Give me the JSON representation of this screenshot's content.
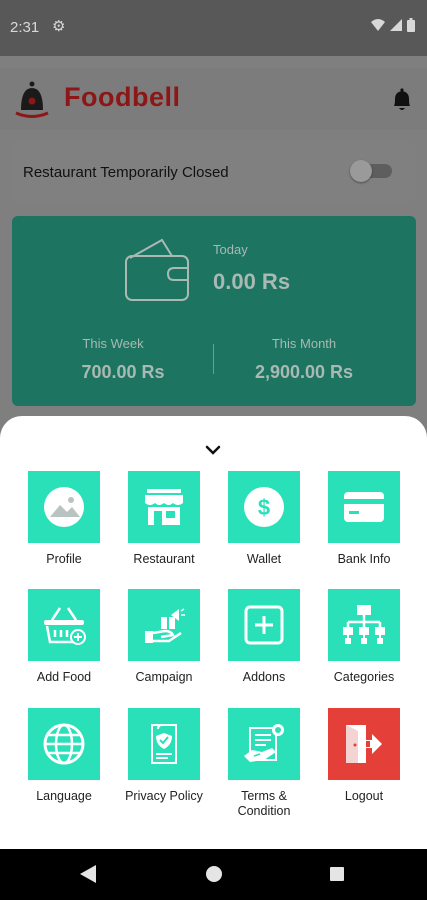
{
  "status_bar": {
    "time": "2:31"
  },
  "app": {
    "logo_text": "Foodbell"
  },
  "restaurant_status": {
    "label": "Restaurant Temporarily Closed",
    "toggle_on": false
  },
  "earnings": {
    "today_label": "Today",
    "today_value": "0.00 Rs",
    "week_label": "This Week",
    "week_value": "700.00 Rs",
    "month_label": "This Month",
    "month_value": "2,900.00 Rs"
  },
  "menu": {
    "items": [
      {
        "label": "Profile",
        "icon": "profile-image-icon"
      },
      {
        "label": "Restaurant",
        "icon": "storefront-icon"
      },
      {
        "label": "Wallet",
        "icon": "dollar-icon"
      },
      {
        "label": "Bank Info",
        "icon": "credit-card-icon"
      },
      {
        "label": "Add Food",
        "icon": "basket-add-icon"
      },
      {
        "label": "Campaign",
        "icon": "campaign-icon"
      },
      {
        "label": "Addons",
        "icon": "plus-square-icon"
      },
      {
        "label": "Categories",
        "icon": "hierarchy-icon"
      },
      {
        "label": "Language",
        "icon": "globe-icon"
      },
      {
        "label": "Privacy Policy",
        "icon": "privacy-document-icon"
      },
      {
        "label": "Terms & Condition",
        "icon": "contract-icon"
      },
      {
        "label": "Logout",
        "icon": "logout-icon"
      }
    ]
  },
  "colors": {
    "tile": "#2ae0b9",
    "logout_tile": "#e53f3a",
    "earnings_card": "#1d7460"
  }
}
